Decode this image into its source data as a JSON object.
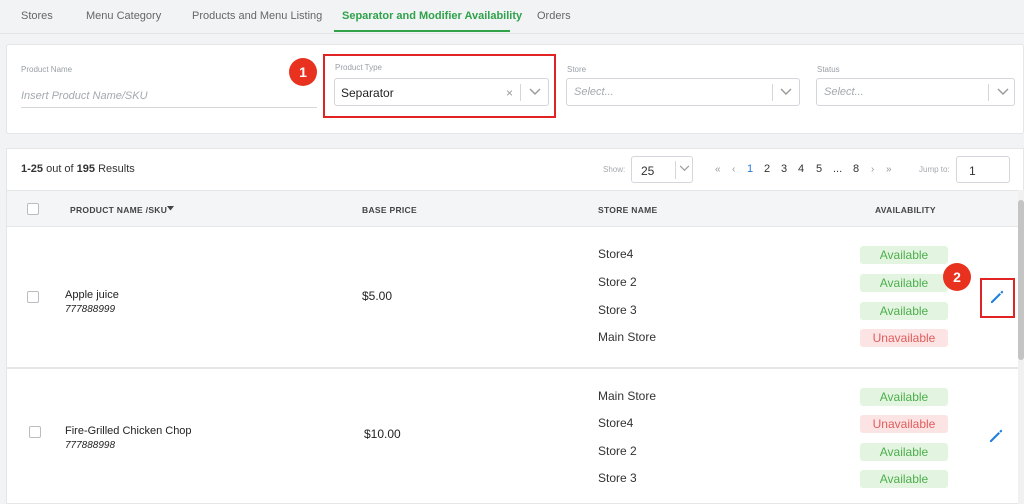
{
  "tabs": [
    {
      "label": "Stores"
    },
    {
      "label": "Menu Category"
    },
    {
      "label": "Products and Menu Listing"
    },
    {
      "label": "Separator and Modifier Availability",
      "active": true
    },
    {
      "label": "Orders"
    }
  ],
  "filters": {
    "product_name": {
      "label": "Product Name",
      "placeholder": "Insert Product Name/SKU"
    },
    "product_type": {
      "label": "Product Type",
      "value": "Separator",
      "clear_icon": "×"
    },
    "store": {
      "label": "Store",
      "placeholder": "Select..."
    },
    "status": {
      "label": "Status",
      "placeholder": "Select..."
    }
  },
  "callouts": {
    "one": "1",
    "two": "2"
  },
  "results": {
    "range": "1-25",
    "out_of": " out of ",
    "total": "195",
    "suffix": " Results",
    "show_label": "Show:",
    "per_page": "25",
    "pager": {
      "first": "«",
      "prev": "‹",
      "pages": [
        "1",
        "2",
        "3",
        "4",
        "5",
        "...",
        "8"
      ],
      "next": "›",
      "last": "»"
    },
    "jump_label": "Jump to:",
    "jump_value": "1"
  },
  "table": {
    "headers": {
      "product": "PRODUCT NAME /SKU",
      "price": "BASE PRICE",
      "store": "STORE NAME",
      "availability": "AVAILABILITY"
    },
    "rows": [
      {
        "name": "Apple juice",
        "sku": "777888999",
        "price": "$5.00",
        "stores": [
          {
            "store": "Store4",
            "availability": "Available"
          },
          {
            "store": "Store 2",
            "availability": "Available"
          },
          {
            "store": "Store 3",
            "availability": "Available"
          },
          {
            "store": "Main Store",
            "availability": "Unavailable"
          }
        ]
      },
      {
        "name": "Fire-Grilled Chicken Chop",
        "sku": "777888998",
        "price": "$10.00",
        "stores": [
          {
            "store": "Main Store",
            "availability": "Available"
          },
          {
            "store": "Store4",
            "availability": "Unavailable"
          },
          {
            "store": "Store 2",
            "availability": "Available"
          },
          {
            "store": "Store 3",
            "availability": "Available"
          }
        ]
      }
    ]
  },
  "colors": {
    "accent_green": "#2fa24a",
    "highlight_red": "#e02424",
    "edit_blue": "#1f7fe0",
    "available_bg": "#e3f5e1",
    "unavailable_bg": "#fde4e4"
  },
  "icons": {
    "edit": "pencil-icon",
    "sort": "caret-down-icon",
    "dropdown": "chevron-down-icon",
    "clear": "close-icon"
  }
}
